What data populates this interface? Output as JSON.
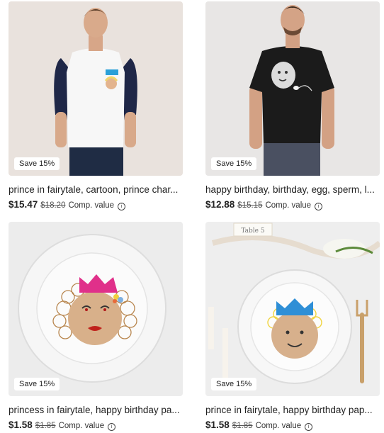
{
  "products": [
    {
      "title": "prince in fairytale, cartoon, prince char...",
      "price": "$15.47",
      "original_price": "$18.20",
      "comp_label": "Comp. value",
      "badge": "Save 15%",
      "image": "model-raglan-tshirt"
    },
    {
      "title": "happy birthday, birthday, egg, sperm, l...",
      "price": "$12.88",
      "original_price": "$15.15",
      "comp_label": "Comp. value",
      "badge": "Save 15%",
      "image": "model-black-tshirt"
    },
    {
      "title": "princess in fairytale, happy birthday pa...",
      "price": "$1.58",
      "original_price": "$1.85",
      "comp_label": "Comp. value",
      "badge": "Save 15%",
      "image": "paper-plate-princess"
    },
    {
      "title": "prince in fairytale, happy birthday pap...",
      "price": "$1.58",
      "original_price": "$1.85",
      "comp_label": "Comp. value",
      "badge": "Save 15%",
      "image": "paper-plate-prince",
      "place_card_text": "Table 5"
    }
  ],
  "colors": {
    "background": "#ffffff",
    "badge_bg": "#ffffff",
    "text": "#222222"
  }
}
